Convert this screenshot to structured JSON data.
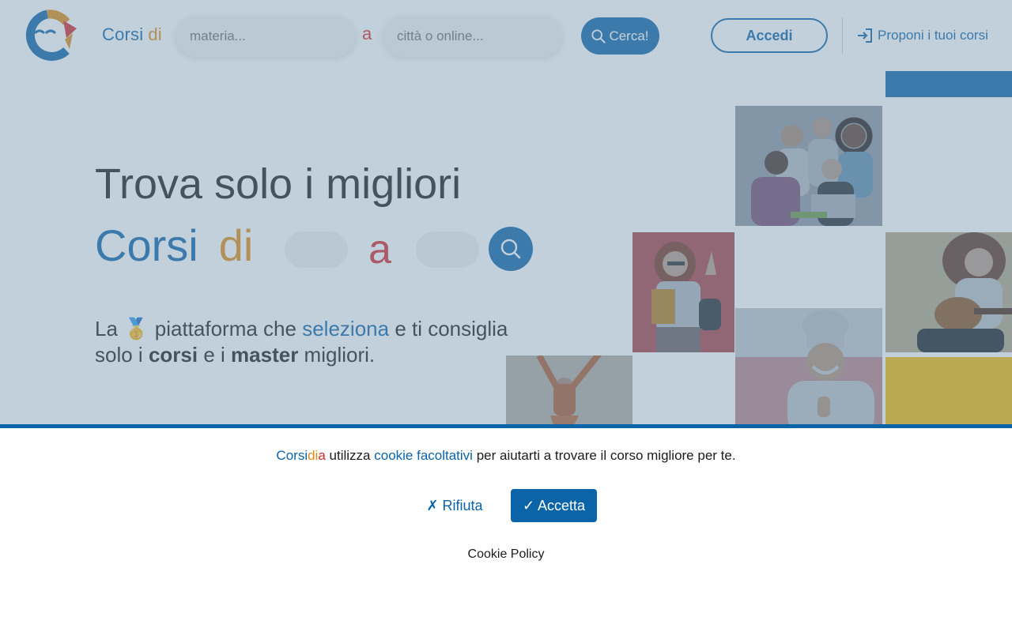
{
  "header": {
    "brand": {
      "part1": "Corsi",
      "part2": "di"
    },
    "search": {
      "subject_placeholder": "materia...",
      "separator": "a",
      "city_placeholder": "città o online...",
      "button_label": "Cerca!"
    },
    "login_label": "Accedi",
    "propose_label": "Proponi i tuoi corsi"
  },
  "hero": {
    "title": "Trova solo i migliori",
    "brand": {
      "part1": "Corsi",
      "part2": "di",
      "separator": "a"
    },
    "text": {
      "t1": "La",
      "medal": "🥇",
      "t2": "piattaforma che",
      "highlight": "seleziona",
      "t3": "e ti consiglia solo i",
      "bold1": "corsi",
      "t4": "e i",
      "bold2": "master",
      "t5": "migliori."
    }
  },
  "cookie_banner": {
    "brand": {
      "p1": "Corsi",
      "p2": "di",
      "p3": "a"
    },
    "text_1": "utilizza",
    "link": "cookie facoltativi",
    "text_2": "per aiutarti a trovare il corso migliore per te.",
    "reject_label": "✗ Rifiuta",
    "accept_label": "✓ Accetta",
    "policy_label": "Cookie Policy"
  },
  "colors": {
    "primary": "#0b63a8",
    "accent_orange": "#e08a14",
    "accent_red": "#d12c2c"
  },
  "icons": [
    "logo-icon",
    "search-icon",
    "sign-in-icon"
  ]
}
